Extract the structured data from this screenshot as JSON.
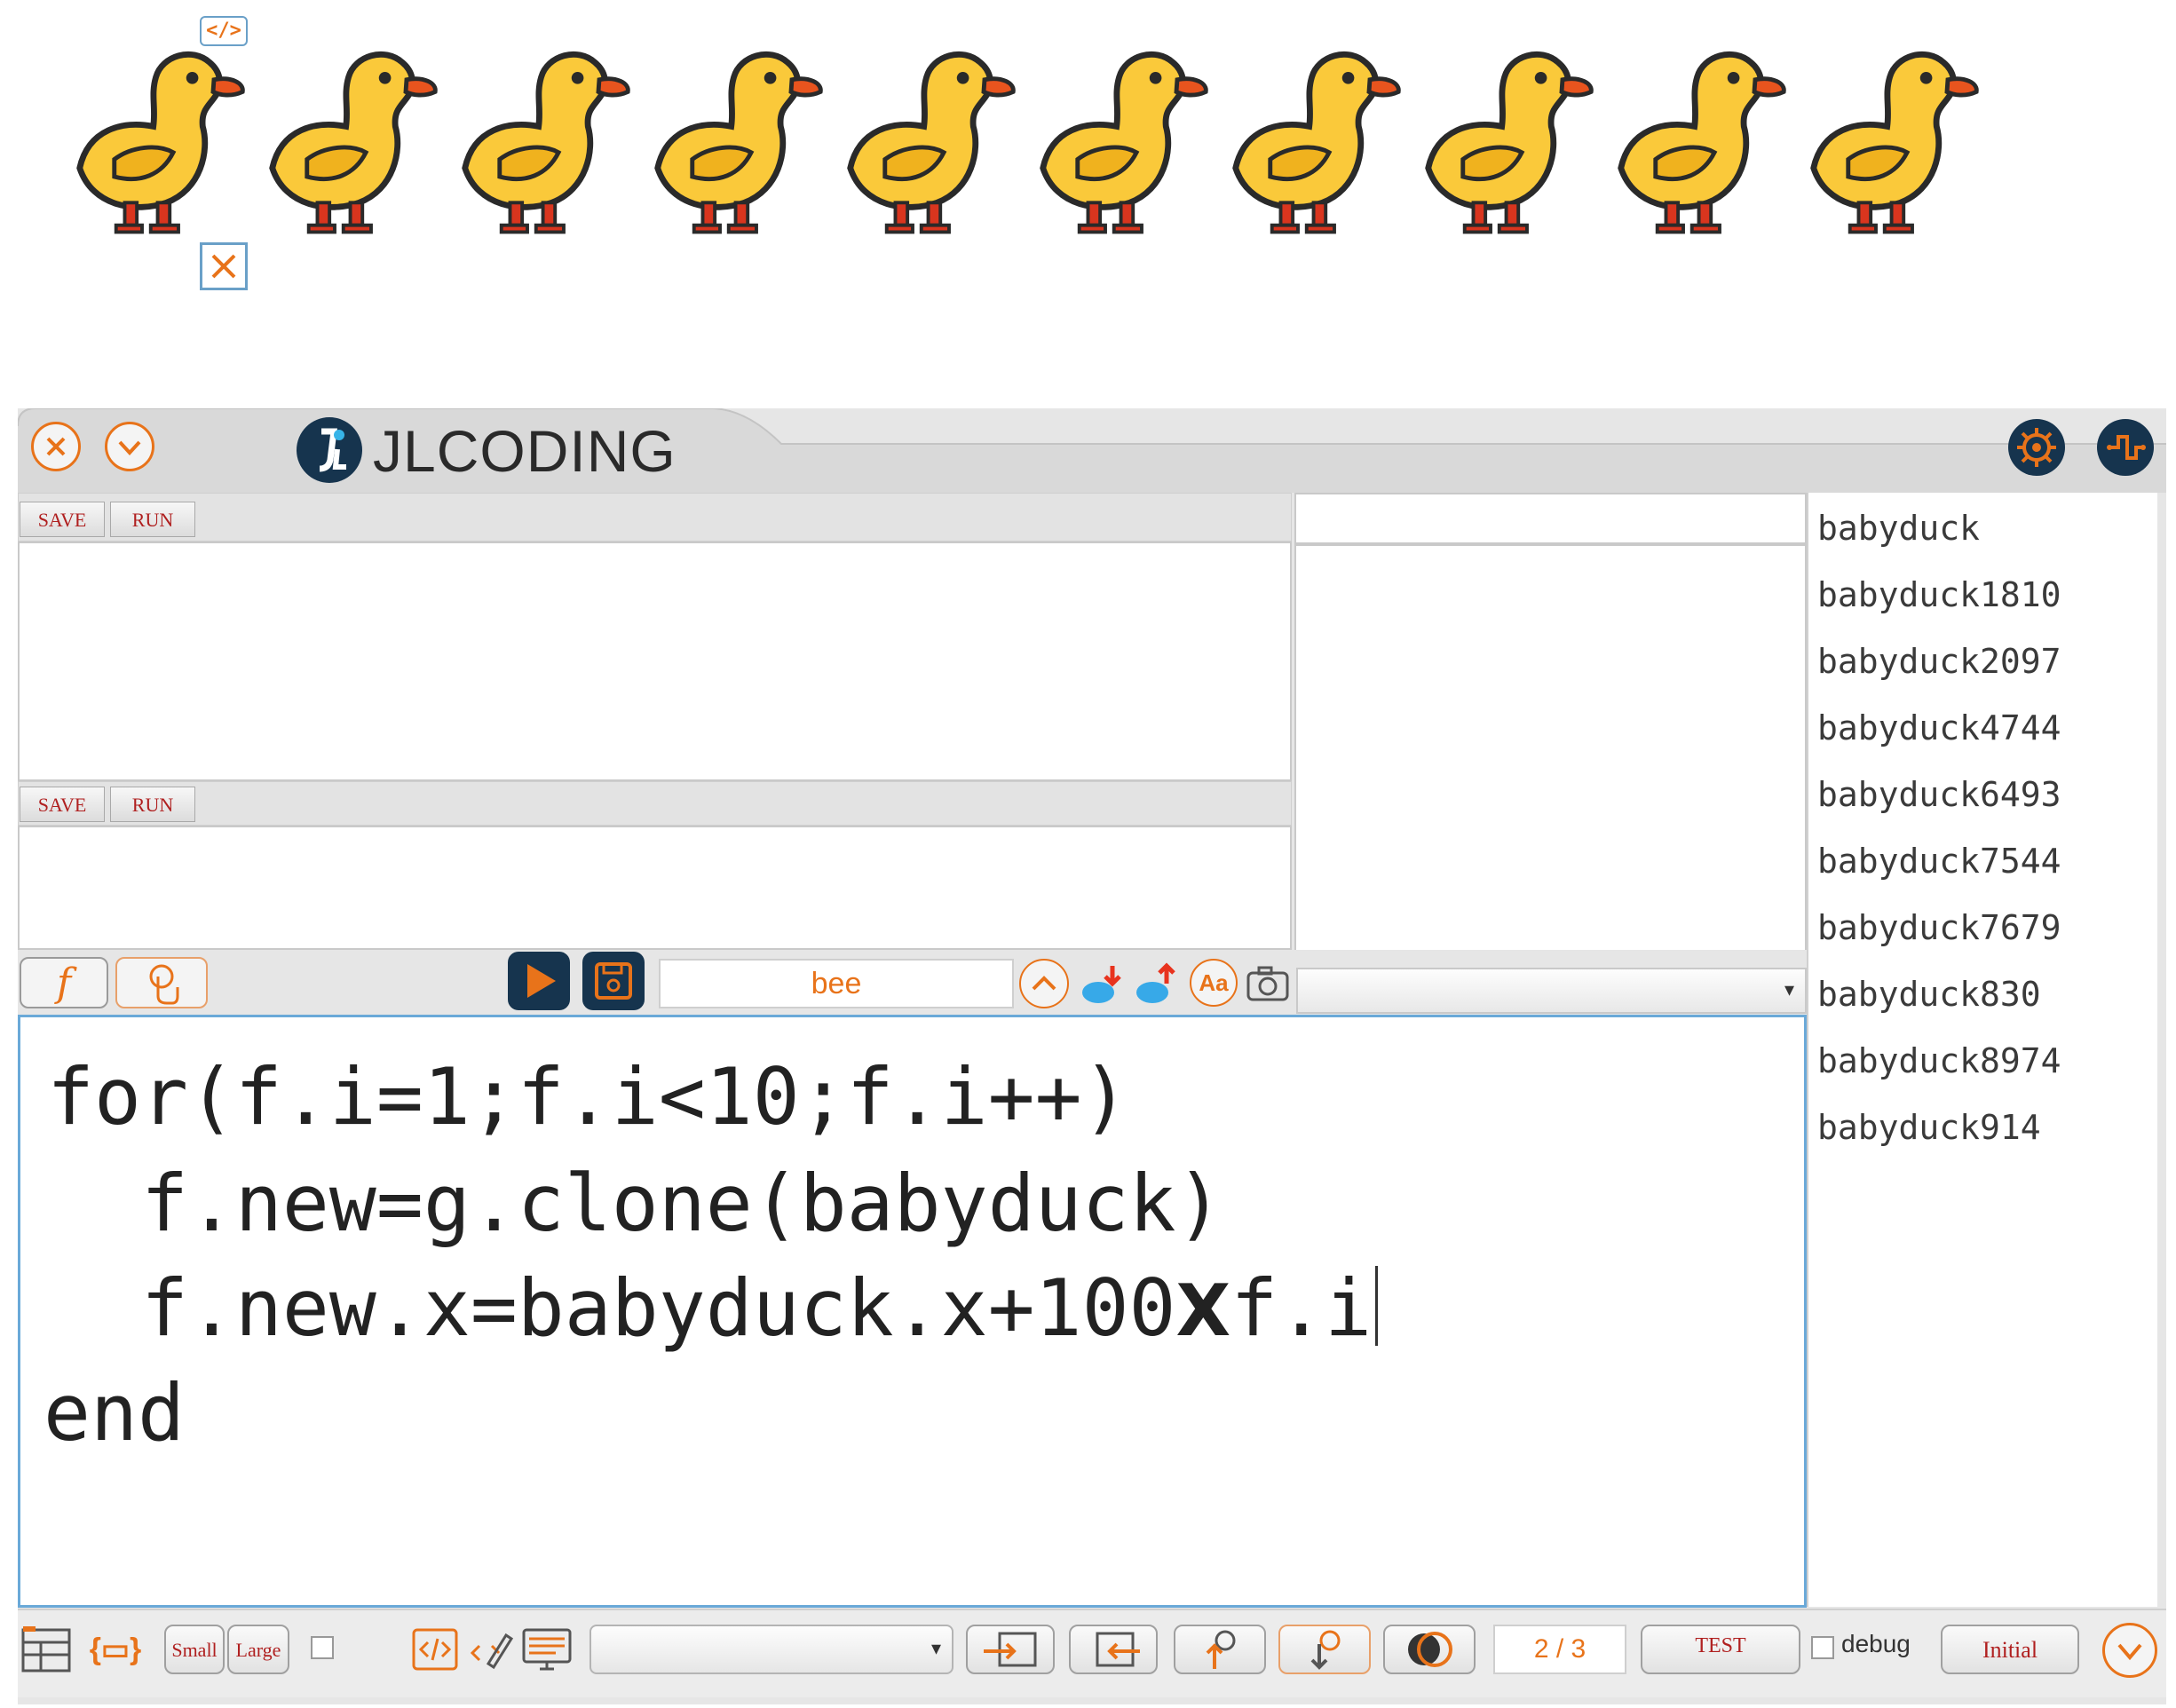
{
  "stage": {
    "duck_count": 10,
    "selection_code_icon": "code-icon",
    "selection_close_icon": "close-icon",
    "code_glyph": "</>"
  },
  "window": {
    "app_title": "JLCODING",
    "close_icon": "close-circle-icon",
    "collapse_icon": "chevron-down-icon",
    "settings_icon": "gear-icon",
    "extra_icon": "circuit-icon",
    "accent_color": "#e8731a",
    "dark_color": "#16344e"
  },
  "panels": {
    "top": {
      "save_label": "SAVE",
      "run_label": "RUN"
    },
    "middle": {
      "save_label": "SAVE",
      "run_label": "RUN"
    }
  },
  "toolbar": {
    "function_glyph": "f",
    "sprite_name_value": "bee",
    "dropdown_value": ""
  },
  "sprite_list": [
    "babyduck",
    "babyduck1810",
    "babyduck2097",
    "babyduck4744",
    "babyduck6493",
    "babyduck7544",
    "babyduck7679",
    "babyduck830",
    "babyduck8974",
    "babyduck914"
  ],
  "code": {
    "line1": "for(f.i=1;f.i<10;f.i++)",
    "line2": "  f.new=g.clone(babyduck)",
    "line3a": "  f.new.x=babyduck.x+100",
    "line3_op": "X",
    "line3b": "f.i",
    "line4": "end"
  },
  "bottombar": {
    "small_label": "Small",
    "large_label": "Large",
    "page_indicator": "2 / 3",
    "test_label": "TEST",
    "debug_label": "debug",
    "initial_label": "Initial",
    "bracket_glyph": "{▭}"
  }
}
